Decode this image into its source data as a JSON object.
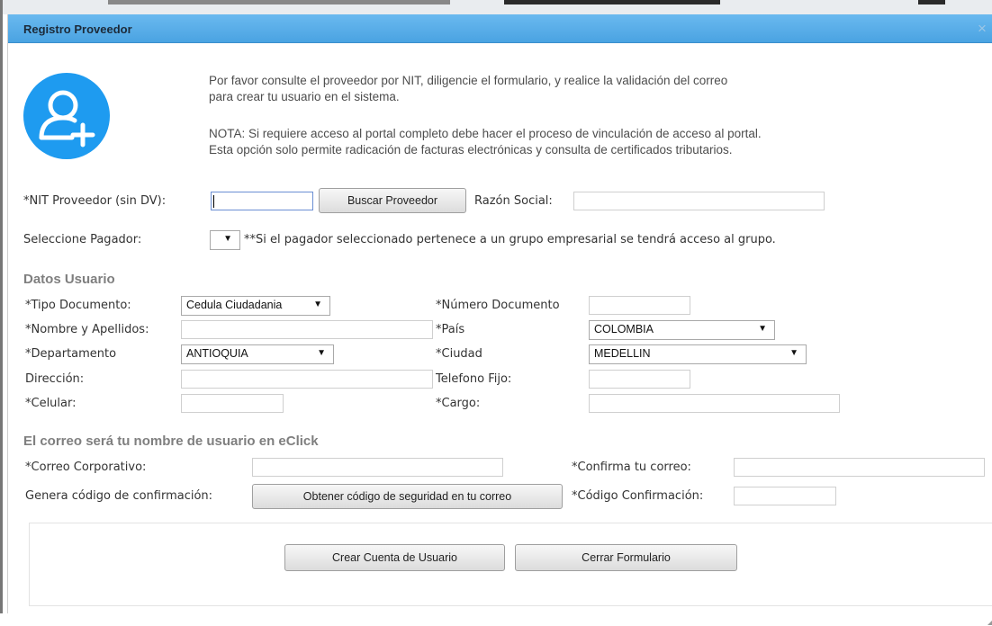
{
  "dialog": {
    "title": "Registro Proveedor",
    "close_label": "×",
    "accent_color": "#4aa3e2"
  },
  "intro": {
    "icon": "user-add-icon",
    "line1": "Por favor consulte el proveedor por NIT, diligencie el formulario, y realice la validación del correo",
    "line2": "para crear tu usuario en el sistema.",
    "line3": "NOTA: Si requiere acceso al portal completo debe hacer el proceso de vinculación de acceso al portal.",
    "line4": "Esta opción solo permite radicación de facturas electrónicas y consulta de certificados tributarios."
  },
  "provider": {
    "nit_label": "*NIT Proveedor (sin DV):",
    "nit_value": "",
    "search_button": "Buscar Proveedor",
    "razon_label": "Razón Social:",
    "razon_value": "",
    "pagador_label": "Seleccione Pagador:",
    "pagador_value": "",
    "pagador_note": "**Si el pagador seleccionado pertenece a un grupo empresarial se tendrá acceso al grupo."
  },
  "user": {
    "section_title": "Datos Usuario",
    "tipo_documento_label": "*Tipo Documento:",
    "tipo_documento_value": "Cedula Ciudadania",
    "numero_documento_label": "*Número Documento",
    "nombre_label": "*Nombre y Apellidos:",
    "pais_label": "*País",
    "pais_value": "COLOMBIA",
    "departamento_label": "*Departamento",
    "departamento_value": "ANTIOQUIA",
    "ciudad_label": "*Ciudad",
    "ciudad_value": "MEDELLIN",
    "direccion_label": "Dirección:",
    "telefono_label": "Telefono Fijo:",
    "celular_label": "*Celular:",
    "cargo_label": "*Cargo:"
  },
  "email": {
    "section_title": "El correo será tu nombre de usuario en eClick",
    "correo_label": "*Correo Corporativo:",
    "confirma_label": "*Confirma tu correo:",
    "genera_label": "Genera código de confirmación:",
    "code_button": "Obtener código de seguridad en tu correo",
    "codigo_label": "*Código Confirmación:"
  },
  "footer": {
    "create_button": "Crear Cuenta de Usuario",
    "close_button": "Cerrar Formulario"
  }
}
